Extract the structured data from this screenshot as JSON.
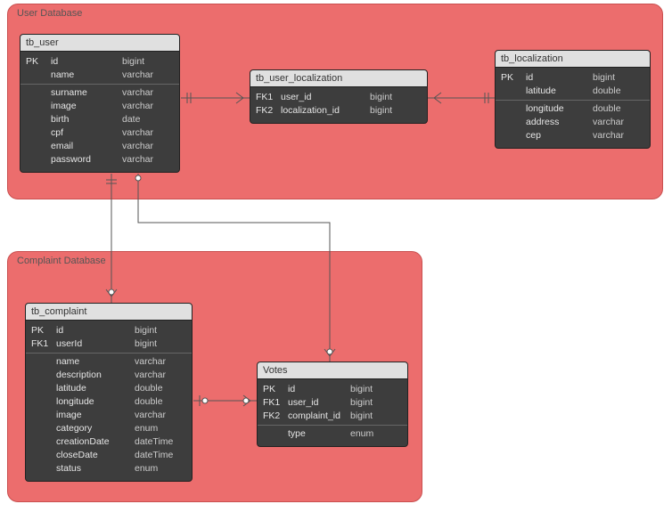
{
  "db1": {
    "label": "User Database",
    "tables": {
      "tb_user": {
        "title": "tb_user",
        "rows": [
          {
            "key": "PK",
            "name": "id",
            "type": "bigint"
          },
          {
            "key": "",
            "name": "name",
            "type": "varchar"
          },
          {
            "sep": true
          },
          {
            "key": "",
            "name": "surname",
            "type": "varchar"
          },
          {
            "key": "",
            "name": "image",
            "type": "varchar"
          },
          {
            "key": "",
            "name": "birth",
            "type": "date"
          },
          {
            "key": "",
            "name": "cpf",
            "type": "varchar"
          },
          {
            "key": "",
            "name": "email",
            "type": "varchar"
          },
          {
            "key": "",
            "name": "password",
            "type": "varchar"
          }
        ]
      },
      "tb_user_localization": {
        "title": "tb_user_localization",
        "rows": [
          {
            "key": "FK1",
            "name": "user_id",
            "type": "bigint"
          },
          {
            "key": "FK2",
            "name": "localization_id",
            "type": "bigint"
          }
        ]
      },
      "tb_localization": {
        "title": "tb_localization",
        "rows": [
          {
            "key": "PK",
            "name": "id",
            "type": "bigint"
          },
          {
            "key": "",
            "name": "latitude",
            "type": "double"
          },
          {
            "sep": true
          },
          {
            "key": "",
            "name": "longitude",
            "type": "double"
          },
          {
            "key": "",
            "name": "address",
            "type": "varchar"
          },
          {
            "key": "",
            "name": "cep",
            "type": "varchar"
          }
        ]
      }
    }
  },
  "db2": {
    "label": "Complaint Database",
    "tables": {
      "tb_complaint": {
        "title": "tb_complaint",
        "rows": [
          {
            "key": "PK",
            "name": "id",
            "type": "bigint"
          },
          {
            "key": "FK1",
            "name": "userId",
            "type": "bigint"
          },
          {
            "sep": true
          },
          {
            "key": "",
            "name": "name",
            "type": "varchar"
          },
          {
            "key": "",
            "name": "description",
            "type": "varchar"
          },
          {
            "key": "",
            "name": "latitude",
            "type": "double"
          },
          {
            "key": "",
            "name": "longitude",
            "type": "double"
          },
          {
            "key": "",
            "name": "image",
            "type": "varchar"
          },
          {
            "key": "",
            "name": "category",
            "type": "enum"
          },
          {
            "key": "",
            "name": "creationDate",
            "type": "dateTime"
          },
          {
            "key": "",
            "name": "closeDate",
            "type": "dateTime"
          },
          {
            "key": "",
            "name": "status",
            "type": "enum"
          }
        ]
      },
      "votes": {
        "title": "Votes",
        "rows": [
          {
            "key": "PK",
            "name": "id",
            "type": "bigint"
          },
          {
            "key": "FK1",
            "name": "user_id",
            "type": "bigint"
          },
          {
            "key": "FK2",
            "name": "complaint_id",
            "type": "bigint"
          },
          {
            "sep": true
          },
          {
            "key": "",
            "name": "type",
            "type": "enum"
          }
        ]
      }
    }
  }
}
